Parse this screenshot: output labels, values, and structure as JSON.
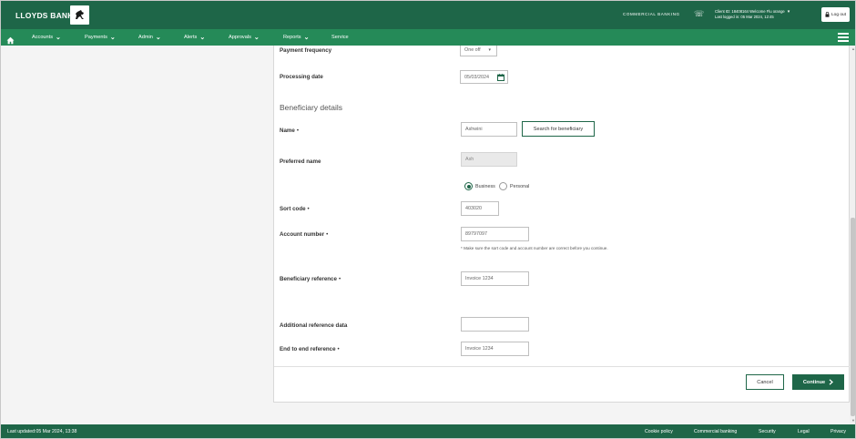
{
  "header": {
    "brand": "LLOYDS BANK",
    "segment": "COMMERCIAL BANKING",
    "client_line": "Client ID: 18408164  Welcome Flu orange",
    "last_logged_in": "Last logged in: 05 Mar 2024, 12:45",
    "logout_label": "Log out"
  },
  "nav": {
    "items": [
      {
        "label": "Accounts"
      },
      {
        "label": "Payments"
      },
      {
        "label": "Admin"
      },
      {
        "label": "Alerts"
      },
      {
        "label": "Approvals"
      },
      {
        "label": "Reports"
      },
      {
        "label": "Service"
      }
    ]
  },
  "form": {
    "payment_frequency": {
      "label": "Payment frequency",
      "value": "One off"
    },
    "processing_date": {
      "label": "Processing date",
      "value": "05/03/2024"
    },
    "section_title": "Beneficiary details",
    "name": {
      "label": "Name",
      "required_mark": "•",
      "value": "Ashwini"
    },
    "search_beneficiary_label": "Search for beneficiary",
    "preferred_name": {
      "label": "Preferred name",
      "value": "Ash"
    },
    "beneficiary_type": {
      "options": [
        "Business",
        "Personal"
      ],
      "selected": "Business"
    },
    "sort_code": {
      "label": "Sort code",
      "required_mark": "•",
      "value": "403020"
    },
    "account_number": {
      "label": "Account number",
      "required_mark": "•",
      "value": "89797097"
    },
    "account_hint": "* Make sure the sort code and account number are correct before you continue.",
    "beneficiary_reference": {
      "label": "Beneficiary reference",
      "required_mark": "•",
      "value": "Invoice 1234"
    },
    "additional_reference": {
      "label": "Additional reference data",
      "value": ""
    },
    "end_to_end_reference": {
      "label": "End to end reference",
      "required_mark": "•",
      "value": "Invoice 1234"
    },
    "cancel_label": "Cancel",
    "continue_label": "Continue"
  },
  "footer": {
    "last_updated": "Last updated:05 Mar 2024, 13:38",
    "links": [
      "Cookie policy",
      "Commercial banking",
      "Security",
      "Legal",
      "Privacy"
    ]
  },
  "colors": {
    "brand_dark": "#1e6648",
    "nav_green": "#258a58",
    "content_bg": "#f4f4f4"
  },
  "icons": [
    "horse-logo-icon",
    "phone-icon",
    "lock-icon",
    "home-icon",
    "chevron-down-icon",
    "menu-icon",
    "calendar-icon",
    "chevron-right-icon"
  ]
}
